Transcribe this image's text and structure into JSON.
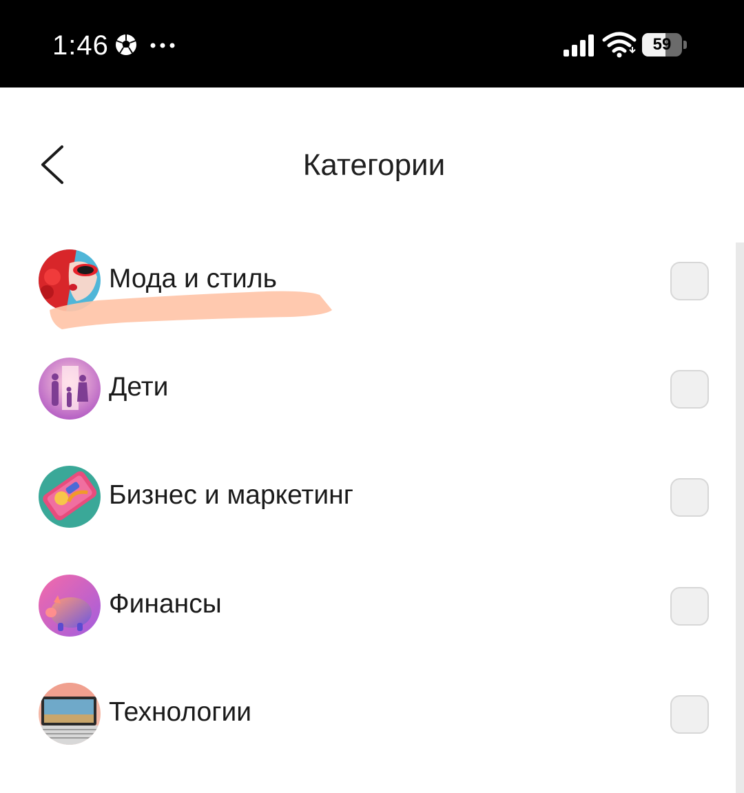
{
  "status_bar": {
    "time": "1:46",
    "battery_level": "59",
    "battery_percent": 59,
    "icons": [
      "soccer-ball-icon",
      "more-dots-icon",
      "cellular-signal-icon",
      "wifi-icon",
      "battery-icon"
    ]
  },
  "header": {
    "title": "Категории",
    "back_icon": "chevron-left-icon"
  },
  "categories": [
    {
      "label": "Мода и стиль",
      "checked": false,
      "icon": "fashion-avatar"
    },
    {
      "label": "Дети",
      "checked": false,
      "icon": "kids-avatar"
    },
    {
      "label": "Бизнес и маркетинг",
      "checked": false,
      "icon": "business-avatar"
    },
    {
      "label": "Финансы",
      "checked": false,
      "icon": "finance-avatar"
    },
    {
      "label": "Технологии",
      "checked": false,
      "icon": "tech-avatar"
    }
  ],
  "colors": {
    "status_bar_bg": "#000000",
    "checkbox_bg": "#f0f0f0",
    "highlight_stroke": "#ffc4a8"
  }
}
